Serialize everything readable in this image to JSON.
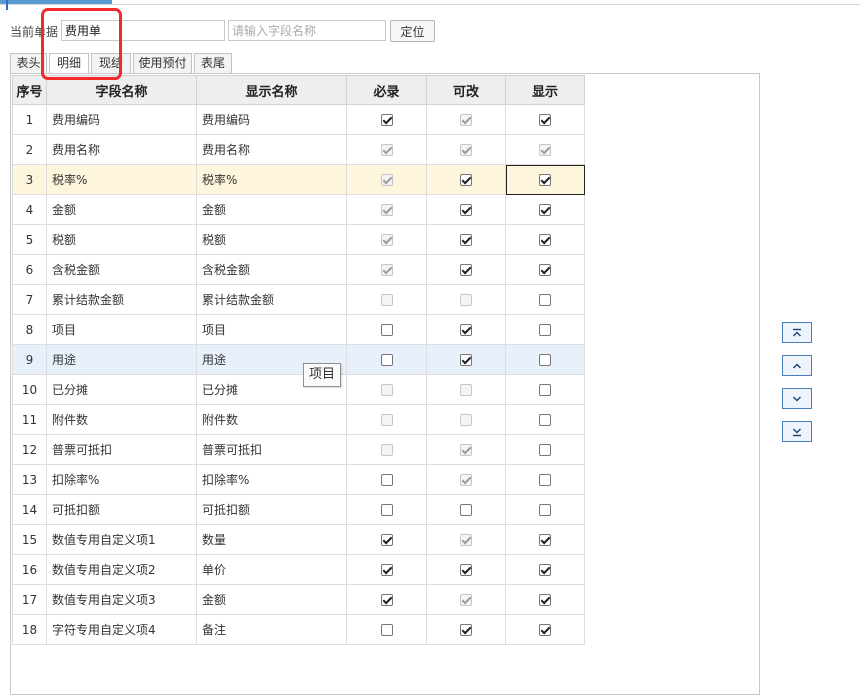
{
  "toolbar": {
    "current_doc_label": "当前单据",
    "current_doc_value": "费用单",
    "search_placeholder": "请输入字段名称",
    "locate_label": "定位"
  },
  "tabs": [
    {
      "label": "表头",
      "active": false
    },
    {
      "label": "明细",
      "active": true
    },
    {
      "label": "现结",
      "active": false
    },
    {
      "label": "使用预付",
      "active": false
    },
    {
      "label": "表尾",
      "active": false
    }
  ],
  "grid": {
    "headers": {
      "index": "序号",
      "field_name": "字段名称",
      "display_name": "显示名称",
      "required": "必录",
      "editable": "可改",
      "visible": "显示"
    },
    "rows": [
      {
        "index": "1",
        "field": "费用编码",
        "display": "费用编码",
        "required": {
          "checked": true,
          "disabled": false
        },
        "editable": {
          "checked": true,
          "disabled": true
        },
        "visible": {
          "checked": true,
          "disabled": false
        }
      },
      {
        "index": "2",
        "field": "费用名称",
        "display": "费用名称",
        "required": {
          "checked": true,
          "disabled": true
        },
        "editable": {
          "checked": true,
          "disabled": true
        },
        "visible": {
          "checked": true,
          "disabled": true
        }
      },
      {
        "index": "3",
        "field": "税率%",
        "display": "税率%",
        "required": {
          "checked": true,
          "disabled": true
        },
        "editable": {
          "checked": true,
          "disabled": false
        },
        "visible": {
          "checked": true,
          "disabled": false
        }
      },
      {
        "index": "4",
        "field": "金额",
        "display": "金额",
        "required": {
          "checked": true,
          "disabled": true
        },
        "editable": {
          "checked": true,
          "disabled": false
        },
        "visible": {
          "checked": true,
          "disabled": false
        }
      },
      {
        "index": "5",
        "field": "税额",
        "display": "税额",
        "required": {
          "checked": true,
          "disabled": true
        },
        "editable": {
          "checked": true,
          "disabled": false
        },
        "visible": {
          "checked": true,
          "disabled": false
        }
      },
      {
        "index": "6",
        "field": "含税金额",
        "display": "含税金额",
        "required": {
          "checked": true,
          "disabled": true
        },
        "editable": {
          "checked": true,
          "disabled": false
        },
        "visible": {
          "checked": true,
          "disabled": false
        }
      },
      {
        "index": "7",
        "field": "累计结款金额",
        "display": "累计结款金额",
        "required": {
          "checked": false,
          "disabled": true
        },
        "editable": {
          "checked": false,
          "disabled": true
        },
        "visible": {
          "checked": false,
          "disabled": false
        }
      },
      {
        "index": "8",
        "field": "项目",
        "display": "项目",
        "required": {
          "checked": false,
          "disabled": false
        },
        "editable": {
          "checked": true,
          "disabled": false
        },
        "visible": {
          "checked": false,
          "disabled": false
        }
      },
      {
        "index": "9",
        "field": "用途",
        "display": "用途",
        "required": {
          "checked": false,
          "disabled": false
        },
        "editable": {
          "checked": true,
          "disabled": false
        },
        "visible": {
          "checked": false,
          "disabled": false
        }
      },
      {
        "index": "10",
        "field": "已分摊",
        "display": "已分摊",
        "required": {
          "checked": false,
          "disabled": true
        },
        "editable": {
          "checked": false,
          "disabled": true
        },
        "visible": {
          "checked": false,
          "disabled": false
        }
      },
      {
        "index": "11",
        "field": "附件数",
        "display": "附件数",
        "required": {
          "checked": false,
          "disabled": true
        },
        "editable": {
          "checked": false,
          "disabled": true
        },
        "visible": {
          "checked": false,
          "disabled": false
        }
      },
      {
        "index": "12",
        "field": "普票可抵扣",
        "display": "普票可抵扣",
        "required": {
          "checked": false,
          "disabled": true
        },
        "editable": {
          "checked": true,
          "disabled": true
        },
        "visible": {
          "checked": false,
          "disabled": false
        }
      },
      {
        "index": "13",
        "field": "扣除率%",
        "display": "扣除率%",
        "required": {
          "checked": false,
          "disabled": false
        },
        "editable": {
          "checked": true,
          "disabled": true
        },
        "visible": {
          "checked": false,
          "disabled": false
        }
      },
      {
        "index": "14",
        "field": "可抵扣额",
        "display": "可抵扣额",
        "required": {
          "checked": false,
          "disabled": false
        },
        "editable": {
          "checked": false,
          "disabled": false
        },
        "visible": {
          "checked": false,
          "disabled": false
        }
      },
      {
        "index": "15",
        "field": "数值专用自定义项1",
        "display": "数量",
        "required": {
          "checked": true,
          "disabled": false
        },
        "editable": {
          "checked": true,
          "disabled": true
        },
        "visible": {
          "checked": true,
          "disabled": false
        }
      },
      {
        "index": "16",
        "field": "数值专用自定义项2",
        "display": "单价",
        "required": {
          "checked": true,
          "disabled": false
        },
        "editable": {
          "checked": true,
          "disabled": false
        },
        "visible": {
          "checked": true,
          "disabled": false
        }
      },
      {
        "index": "17",
        "field": "数值专用自定义项3",
        "display": "金额",
        "required": {
          "checked": true,
          "disabled": false
        },
        "editable": {
          "checked": true,
          "disabled": true
        },
        "visible": {
          "checked": true,
          "disabled": false
        }
      },
      {
        "index": "18",
        "field": "字符专用自定义项4",
        "display": "备注",
        "required": {
          "checked": false,
          "disabled": false
        },
        "editable": {
          "checked": true,
          "disabled": false
        },
        "visible": {
          "checked": true,
          "disabled": false
        }
      }
    ],
    "highlighted_row": "3",
    "hover_row": "9"
  },
  "tooltip": {
    "text": "项目"
  },
  "side_buttons": [
    {
      "name": "move-top-button",
      "icon": "double-up-arrow-icon"
    },
    {
      "name": "move-up-button",
      "icon": "up-arrow-icon"
    },
    {
      "name": "move-down-button",
      "icon": "down-arrow-icon"
    },
    {
      "name": "move-bottom-button",
      "icon": "double-down-arrow-icon"
    }
  ],
  "colors": {
    "highlight_row": "#fdf5dc",
    "hover_row": "#e8f1fb",
    "annotation_box": "#f22a2a",
    "accent": "#4a7ebb"
  }
}
